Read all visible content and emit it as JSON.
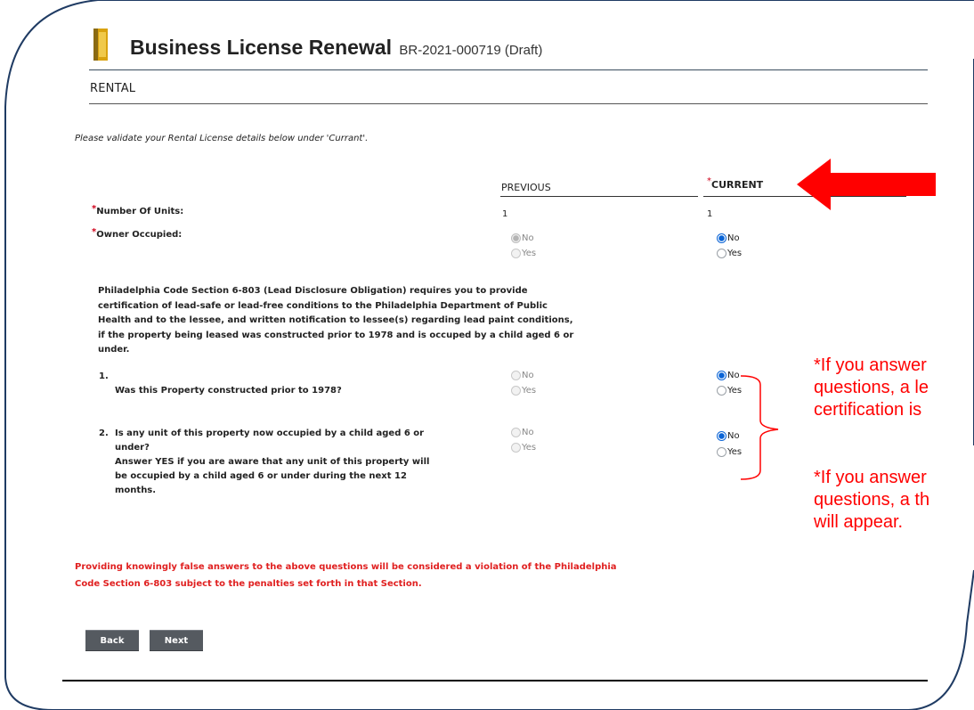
{
  "header": {
    "title": "Business License Renewal",
    "record_id": "BR-2021-000719 (Draft)"
  },
  "section": {
    "title": "RENTAL"
  },
  "intro": "Please validate your Rental License details below under 'Currant'.",
  "columns": {
    "previous": "PREVIOUS",
    "current": "CURRENT",
    "required_mark": "*"
  },
  "fields": {
    "units": {
      "label": "Number Of Units:",
      "previous": "1",
      "current": "1"
    },
    "owner": {
      "label": "Owner Occupied:",
      "no": "No",
      "yes": "Yes",
      "previous_selected": "No",
      "current_selected": "No"
    }
  },
  "lead_paragraph": "Philadelphia Code Section 6-803 (Lead Disclosure Obligation) requires you to provide certification of lead-safe or lead-free conditions to the Philadelphia Department of Public Health and to the lessee, and written notification to lessee(s) regarding lead paint conditions, if the property being leased was constructed prior to 1978 and is occuped by a child aged 6 or under.",
  "questions": [
    {
      "number": "1.",
      "text": "Was this Property constructed prior to 1978?",
      "previous_selected": "none",
      "current_selected": "No"
    },
    {
      "number": "2.",
      "text": "Is any unit of this property now occupied by a child aged 6 or under?",
      "note": "Answer YES if you are aware that any unit of this property will be occupied by a child aged 6 or under during the next 12 months.",
      "previous_selected": "none",
      "current_selected": "No"
    }
  ],
  "options": {
    "no": "No",
    "yes": "Yes"
  },
  "warning": "Providing knowingly false answers to the above questions will be considered a violation of the Philadelphia Code Section 6-803 subject to the penalties set forth in that Section.",
  "buttons": {
    "back": "Back",
    "next": "Next"
  },
  "annotations": {
    "note1": "*If you answer\nquestions, a le\ncertification is",
    "note2": "*If you answer\nquestions, a th\nwill appear."
  },
  "colors": {
    "annotation_red": "#ff0000",
    "frame": "#1f3b63",
    "radio_selected": "#0a64d6",
    "warning_text": "#e02020"
  }
}
